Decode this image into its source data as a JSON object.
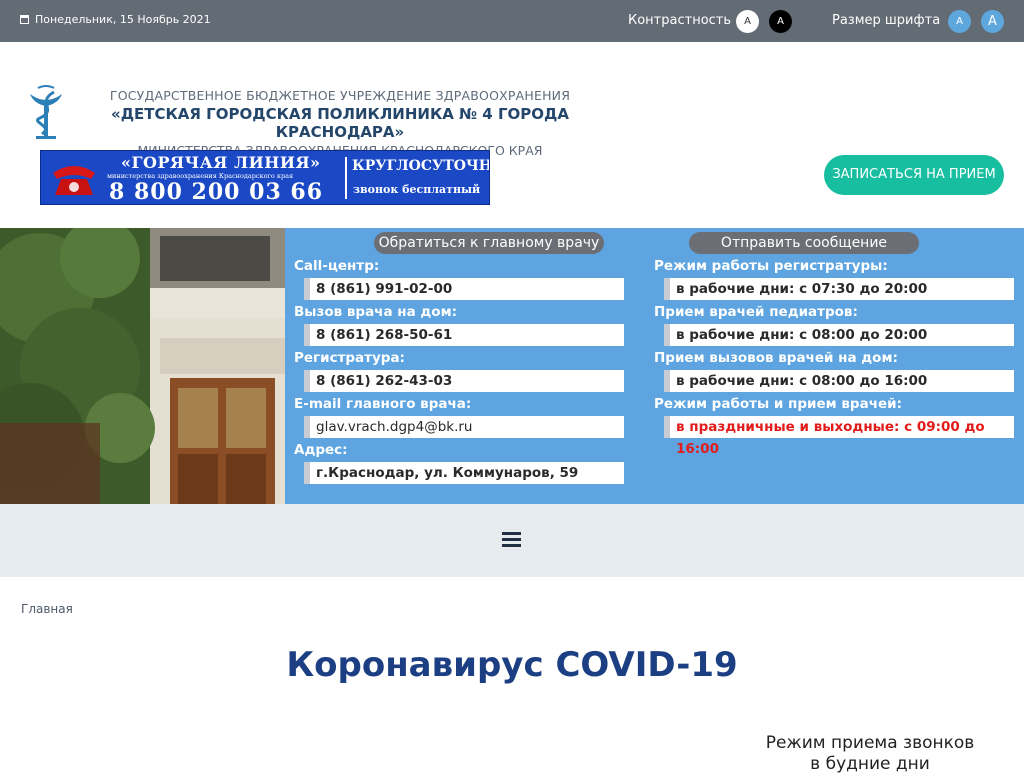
{
  "topbar": {
    "date": "Понедельник, 15 Ноябрь 2021",
    "contrast_label": "Контрастность",
    "contrast_white": "A",
    "contrast_black": "A",
    "font_size_label": "Размер шрифта",
    "font_small": "A",
    "font_large": "A"
  },
  "header": {
    "org_line1": "ГОСУДАРСТВЕННОЕ БЮДЖЕТНОЕ УЧРЕЖДЕНИЕ ЗДРАВООХРАНЕНИЯ",
    "org_line2": "«ДЕТСКАЯ ГОРОДСКАЯ ПОЛИКЛИНИКА № 4 ГОРОДА КРАСНОДАРА»",
    "org_line3": "МИНИСТЕРСТВА ЗДРАВООХРАНЕНИЯ КРАСНОДАРСКОГО КРАЯ",
    "appointment_button": "ЗАПИСАТЬСЯ НА ПРИЕМ"
  },
  "hotline": {
    "title": "«ГОРЯЧАЯ ЛИНИЯ»",
    "subtitle": "министерства здравоохранения Краснодарского края",
    "phone": "8 800 200 03 66",
    "round_clock": "КРУГЛОСУТОЧНО",
    "free_call": "звонок бесплатный"
  },
  "info": {
    "left_button": "Обратиться к главному врачу",
    "right_button": "Отправить сообщение",
    "left": [
      {
        "label": "Call-центр:",
        "value": "8 (861) 991-02-00"
      },
      {
        "label": "Вызов врача на дом:",
        "value": "8 (861) 268-50-61"
      },
      {
        "label": "Регистратура:",
        "value": "8 (861) 262-43-03"
      },
      {
        "label": "E-mail главного врача:",
        "value": "glav.vrach.dgp4@bk.ru"
      },
      {
        "label": "Адрес:",
        "value": "г.Краснодар, ул. Коммунаров, 59"
      }
    ],
    "right": [
      {
        "label": "Режим работы регистратуры:",
        "value": "в рабочие дни: с 07:30 до 20:00"
      },
      {
        "label": "Прием врачей педиатров:",
        "value": "в рабочие дни: с 08:00 до 20:00"
      },
      {
        "label": "Прием вызовов врачей на дом:",
        "value": "в рабочие дни: с 08:00 до 16:00"
      },
      {
        "label": "Режим работы и прием врачей:",
        "value": "в праздничные и выходные: с 09:00 до 16:00"
      }
    ]
  },
  "breadcrumb": "Главная",
  "page_title": "Коронавирус COVID-19",
  "side_text_line1": "Режим приема звонков",
  "side_text_line2": "в будние дни",
  "icons": {
    "date": "calendar-icon",
    "logo": "caduceus-logo-icon",
    "menu": "hamburger-menu-icon",
    "hotline": "red-telephone-icon"
  },
  "colors": {
    "topbar": "#636b75",
    "info_panel": "#5ea4e0",
    "appointment_button": "#17bea0",
    "title": "#1c3f83",
    "holiday_text": "#e21b1b"
  }
}
